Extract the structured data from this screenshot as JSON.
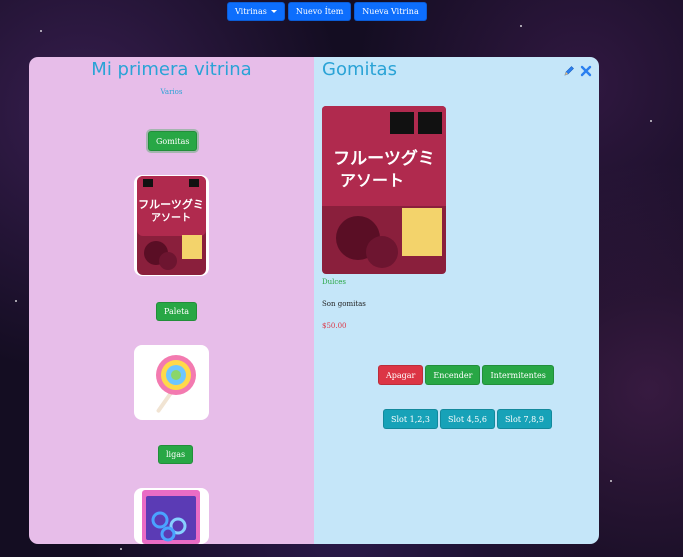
{
  "nav": {
    "vitrinas_label": "Vitrinas",
    "new_item_label": "Nuevo Ítem",
    "new_showcase_label": "Nueva Vitrina"
  },
  "showcase": {
    "title": "Mi primera vitrina",
    "subtitle": "Varios",
    "items": [
      {
        "label": "Gomitas",
        "image": "gummy-candy-bag"
      },
      {
        "label": "Paleta",
        "image": "swirl-lollipop"
      },
      {
        "label": "ligas",
        "image": "hair-ties-package"
      }
    ]
  },
  "detail": {
    "title": "Gomitas",
    "category": "Dulces",
    "description": "Son gomitas",
    "price": "$50.00",
    "edit_icon": "pencil-icon",
    "delete_icon": "close-icon",
    "controls": {
      "off_label": "Apagar",
      "on_label": "Encender",
      "blink_label": "Intermitentes"
    },
    "slots": [
      "Slot 1,2,3",
      "Slot 4,5,6",
      "Slot 7,8,9"
    ]
  },
  "colors": {
    "primary": "#0d6efd",
    "success": "#28a745",
    "danger": "#dc3545",
    "info": "#17a2b8",
    "title": "#2aa3d6",
    "left_panel": "#e7bde9",
    "right_panel": "#c5e6f9"
  }
}
